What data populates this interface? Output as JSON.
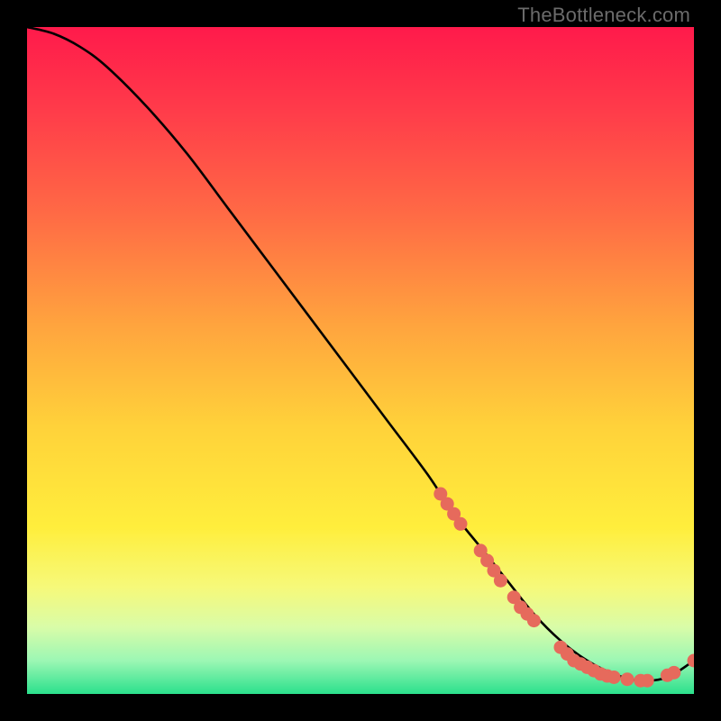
{
  "watermark": "TheBottleneck.com",
  "chart_data": {
    "type": "line",
    "title": "",
    "xlabel": "",
    "ylabel": "",
    "xlim": [
      0,
      100
    ],
    "ylim": [
      0,
      100
    ],
    "gradient_stops": [
      {
        "offset": 0,
        "color": "#ff1a4b"
      },
      {
        "offset": 12,
        "color": "#ff3a4a"
      },
      {
        "offset": 28,
        "color": "#ff6a45"
      },
      {
        "offset": 45,
        "color": "#ffa53e"
      },
      {
        "offset": 60,
        "color": "#ffd23a"
      },
      {
        "offset": 75,
        "color": "#ffee3c"
      },
      {
        "offset": 84,
        "color": "#f6f97a"
      },
      {
        "offset": 90,
        "color": "#d9fca8"
      },
      {
        "offset": 95,
        "color": "#9cf7b4"
      },
      {
        "offset": 100,
        "color": "#2be08c"
      }
    ],
    "series": [
      {
        "name": "bottleneck-curve",
        "x": [
          0,
          4,
          8,
          12,
          18,
          24,
          30,
          36,
          42,
          48,
          54,
          60,
          64,
          68,
          72,
          76,
          80,
          84,
          88,
          92,
          96,
          100
        ],
        "y": [
          100,
          99,
          97,
          94,
          88,
          81,
          73,
          65,
          57,
          49,
          41,
          33,
          27,
          22,
          17,
          12,
          8,
          5,
          3,
          2,
          2.5,
          5
        ]
      }
    ],
    "markers": {
      "name": "highlighted-points",
      "color": "#e66a5c",
      "points": [
        {
          "x": 62,
          "y": 30
        },
        {
          "x": 63,
          "y": 28.5
        },
        {
          "x": 64,
          "y": 27
        },
        {
          "x": 65,
          "y": 25.5
        },
        {
          "x": 68,
          "y": 21.5
        },
        {
          "x": 69,
          "y": 20
        },
        {
          "x": 70,
          "y": 18.5
        },
        {
          "x": 71,
          "y": 17
        },
        {
          "x": 73,
          "y": 14.5
        },
        {
          "x": 74,
          "y": 13
        },
        {
          "x": 75,
          "y": 12
        },
        {
          "x": 76,
          "y": 11
        },
        {
          "x": 80,
          "y": 7
        },
        {
          "x": 81,
          "y": 6
        },
        {
          "x": 82,
          "y": 5
        },
        {
          "x": 83,
          "y": 4.5
        },
        {
          "x": 84,
          "y": 4
        },
        {
          "x": 85,
          "y": 3.5
        },
        {
          "x": 86,
          "y": 3
        },
        {
          "x": 87,
          "y": 2.7
        },
        {
          "x": 88,
          "y": 2.5
        },
        {
          "x": 90,
          "y": 2.2
        },
        {
          "x": 92,
          "y": 2
        },
        {
          "x": 93,
          "y": 2
        },
        {
          "x": 96,
          "y": 2.8
        },
        {
          "x": 97,
          "y": 3.2
        },
        {
          "x": 100,
          "y": 5
        }
      ]
    }
  }
}
